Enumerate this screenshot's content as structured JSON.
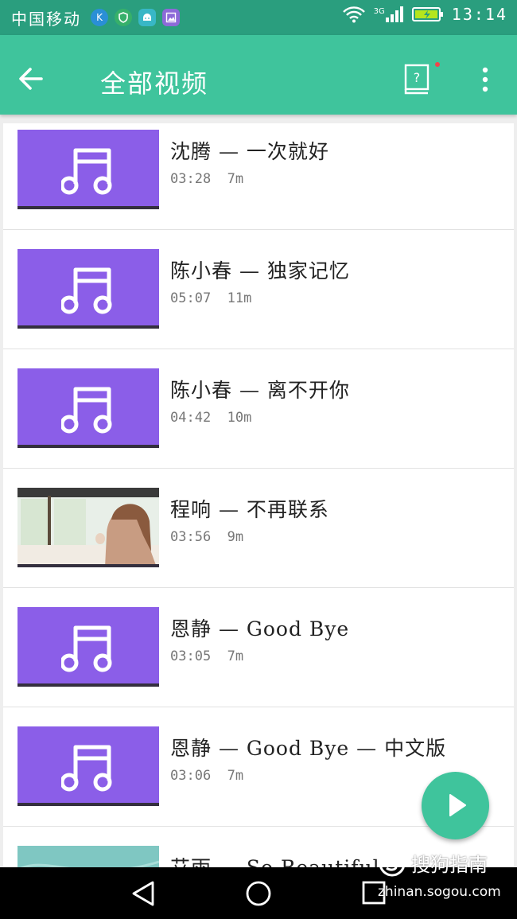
{
  "status_bar": {
    "carrier": "中国移动",
    "network_label": "3G",
    "time": "13:14",
    "notification_icons": [
      "k-icon",
      "shield-icon",
      "android-icon",
      "image-icon"
    ]
  },
  "app_bar": {
    "title": "全部视频",
    "help_glyph": "?"
  },
  "videos": [
    {
      "title": "沈腾 — 一次就好",
      "duration": "03:28",
      "size": "7m",
      "thumbnail": "music-note"
    },
    {
      "title": "陈小春 — 独家记忆",
      "duration": "05:07",
      "size": "11m",
      "thumbnail": "music-note"
    },
    {
      "title": "陈小春 — 离不开你",
      "duration": "04:42",
      "size": "10m",
      "thumbnail": "music-note"
    },
    {
      "title": "程响 — 不再联系",
      "duration": "03:56",
      "size": "9m",
      "thumbnail": "photo"
    },
    {
      "title": "恩静 — Good Bye",
      "duration": "03:05",
      "size": "7m",
      "thumbnail": "music-note"
    },
    {
      "title": "恩静 — Good Bye — 中文版",
      "duration": "03:06",
      "size": "7m",
      "thumbnail": "music-note"
    },
    {
      "title": "艾雨 — So Beautiful",
      "duration": "",
      "size": "",
      "thumbnail": "photo-teal"
    }
  ],
  "watermark": {
    "brand": "搜狗指南",
    "url": "zhinan.sogou.com"
  },
  "colors": {
    "primary": "#3fc49c",
    "status_bar": "#2a9e7e",
    "thumbnail_purple": "#8b5ee8",
    "notification_dot": "#f0454b"
  }
}
